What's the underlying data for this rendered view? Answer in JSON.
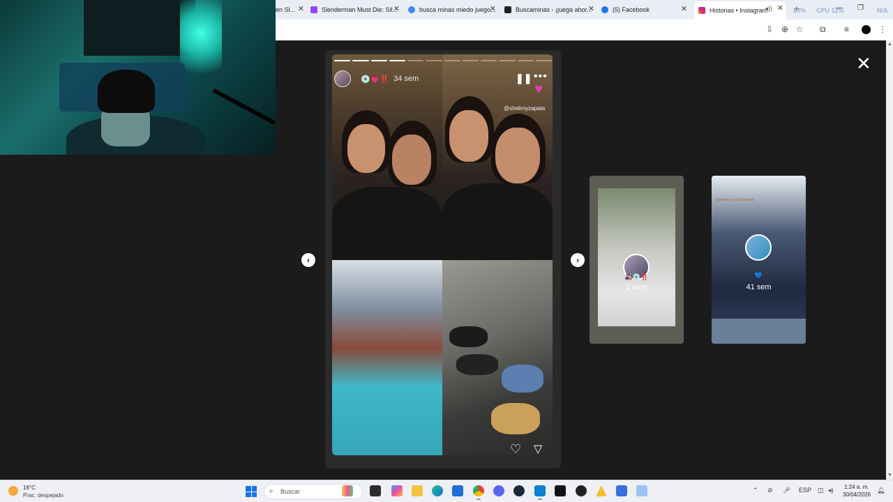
{
  "browser": {
    "tabs": [
      {
        "title": "en Sl...",
        "icon": "tab-generic-icon",
        "color": "#7b5bd6"
      },
      {
        "title": "Slenderman Must Die: Sil...",
        "icon": "twitch-icon",
        "color": "#9146ff"
      },
      {
        "title": "busca minas miedo juego...",
        "icon": "google-icon",
        "color": "#4285f4"
      },
      {
        "title": "Buscaminas - ¡juega ahor...",
        "icon": "minesweeper-icon",
        "color": "#222222"
      },
      {
        "title": "(5) Facebook",
        "icon": "facebook-icon",
        "color": "#1877f2"
      },
      {
        "title": "Historias • Instagram",
        "icon": "instagram-icon",
        "color": "#d6249f",
        "active": true
      }
    ],
    "sysmon": {
      "a": "23%",
      "cpu": "CPU 12%",
      "b": "N/A"
    }
  },
  "story": {
    "username": "💿💗‼️",
    "time": "34 sem",
    "mention": "@shelimyzapata",
    "progress_total": 12,
    "progress_done": 4
  },
  "previews": [
    {
      "name": "🎎💿‼️",
      "time": "1 sem"
    },
    {
      "name": "💙",
      "time": "41 sem",
      "caption": "Matiasito on Chommirea"
    }
  ],
  "taskbar": {
    "weather_temp": "16°C",
    "weather_desc": "Prac. despejado",
    "search_placeholder": "Buscar",
    "lang": "ESP",
    "time": "1:24 a. m.",
    "date": "30/04/2026"
  }
}
